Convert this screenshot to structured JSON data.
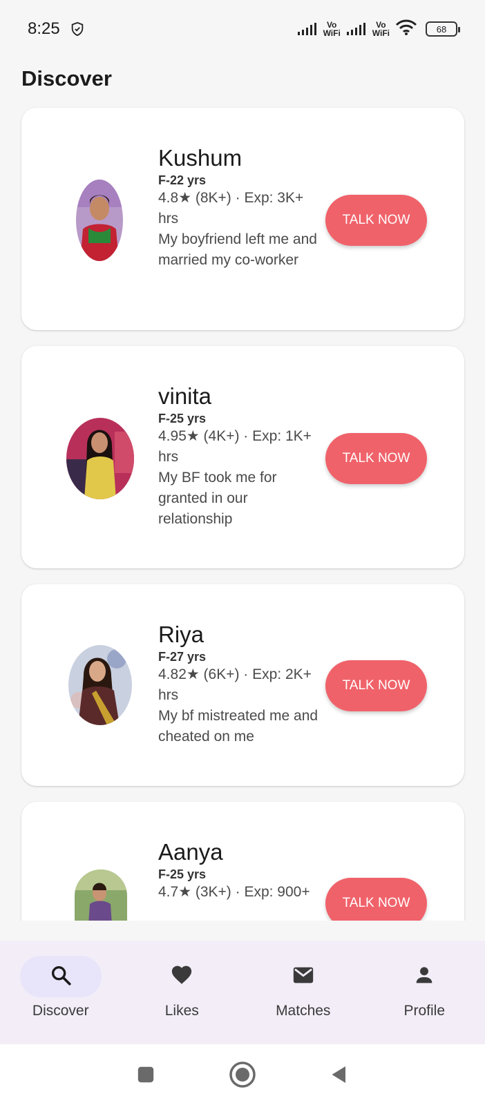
{
  "status_bar": {
    "time": "8:25",
    "vowifi_1_top": "Vo",
    "vowifi_1_bottom": "WiFi",
    "vowifi_2_top": "Vo",
    "vowifi_2_bottom": "WiFi",
    "battery": "68"
  },
  "page": {
    "title": "Discover"
  },
  "profiles": [
    {
      "name": "Kushum",
      "age": "F-22 yrs",
      "stats": "4.8★ (8K+) · Exp: 3K+ hrs",
      "bio": "My boyfriend left me and married my co-worker",
      "button": "TALK NOW"
    },
    {
      "name": "vinita",
      "age": "F-25 yrs",
      "stats": "4.95★ (4K+) · Exp: 1K+ hrs",
      "bio": "My BF took me for granted in our relationship",
      "button": "TALK NOW"
    },
    {
      "name": "Riya",
      "age": "F-27 yrs",
      "stats": "4.82★ (6K+) · Exp: 2K+ hrs",
      "bio": "My bf mistreated me and cheated on me",
      "button": "TALK NOW"
    },
    {
      "name": "Aanya",
      "age": "F-25 yrs",
      "stats": "4.7★ (3K+) · Exp: 900+",
      "bio": "",
      "button": "TALK NOW"
    }
  ],
  "bottom_nav": [
    {
      "label": "Discover",
      "icon": "search-icon",
      "active": true
    },
    {
      "label": "Likes",
      "icon": "heart-icon",
      "active": false
    },
    {
      "label": "Matches",
      "icon": "mail-icon",
      "active": false
    },
    {
      "label": "Profile",
      "icon": "person-icon",
      "active": false
    }
  ],
  "colors": {
    "accent": "#f0626a",
    "nav_background": "#f3edf7",
    "nav_active_pill": "#e8e5fb"
  }
}
